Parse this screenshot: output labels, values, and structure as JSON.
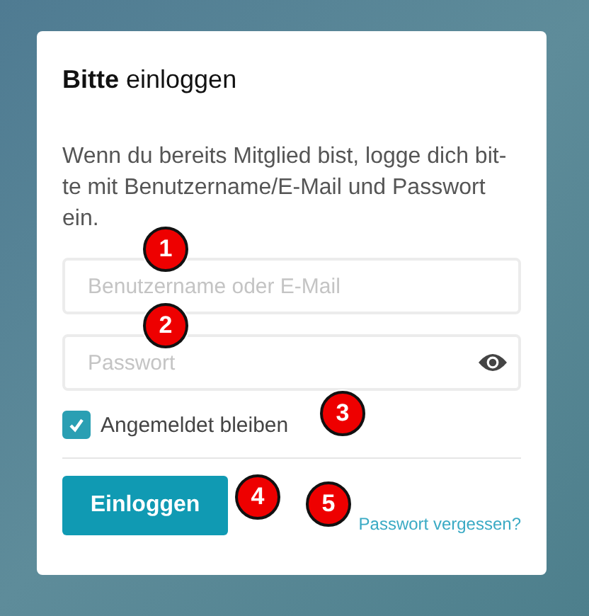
{
  "title": "**Bitte** einloggen",
  "intro": "Wenn du bereits Mitglied bist, logge dich bit-te mit Benutzername/E-Mail und Passwort ein.",
  "username": {
    "placeholder": "Benutzername oder E-Mail"
  },
  "password": {
    "placeholder": "Passwort"
  },
  "remember": {
    "label": "Angemeldet bleiben",
    "checked": true
  },
  "login_button": "Einloggen",
  "forgot_link": "Passwort vergessen?",
  "markers": [
    "1",
    "2",
    "3",
    "4",
    "5"
  ]
}
